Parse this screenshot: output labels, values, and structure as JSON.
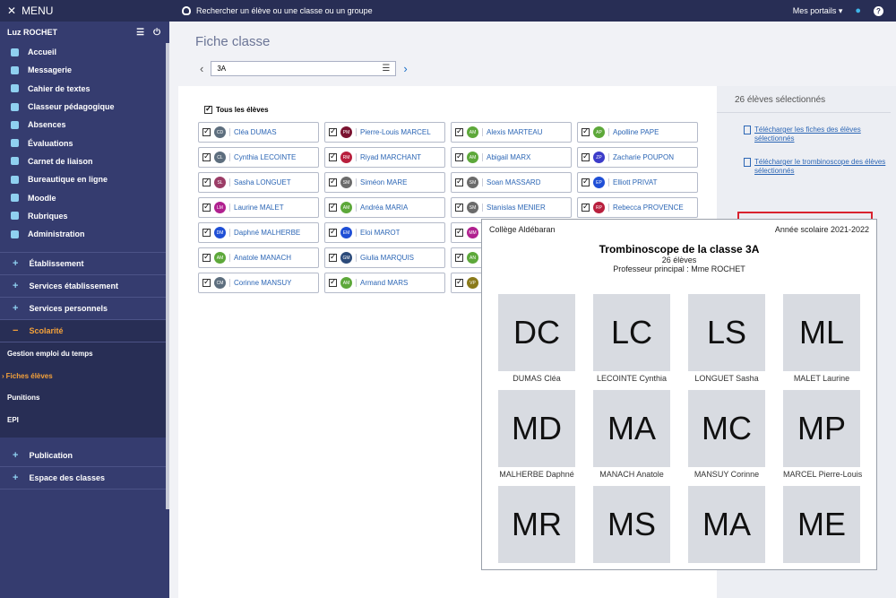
{
  "topbar": {
    "search_text": "Rechercher un élève ou une classe ou un groupe",
    "portals": "Mes portails"
  },
  "sidebar": {
    "menu_label": "MENU",
    "user": "Luz ROCHET",
    "items": [
      "Accueil",
      "Messagerie",
      "Cahier de textes",
      "Classeur pédagogique",
      "Absences",
      "Évaluations",
      "Carnet de liaison",
      "Bureautique en ligne",
      "Moodle",
      "Rubriques",
      "Administration"
    ],
    "sections_top": [
      "Établissement",
      "Services établissement",
      "Services personnels"
    ],
    "active_section": "Scolarité",
    "subitems": [
      "Gestion emploi du temps",
      "Fiches élèves",
      "Punitions",
      "EPI"
    ],
    "sections_bottom": [
      "Publication",
      "Espace des classes"
    ]
  },
  "page": {
    "title": "Fiche classe",
    "class_value": "3A",
    "all_students": "Tous les élèves"
  },
  "students": [
    {
      "name": "Cléa DUMAS",
      "initials": "CD",
      "color": "#5d6e7e"
    },
    {
      "name": "Pierre-Louis MARCEL",
      "initials": "PM",
      "color": "#7a1230"
    },
    {
      "name": "Alexis MARTEAU",
      "initials": "AM",
      "color": "#5da83a"
    },
    {
      "name": "Apolline PAPE",
      "initials": "AP",
      "color": "#5da83a"
    },
    {
      "name": "Cynthia LECOINTE",
      "initials": "CL",
      "color": "#5d6e7e"
    },
    {
      "name": "Riyad MARCHANT",
      "initials": "RM",
      "color": "#b81f3d"
    },
    {
      "name": "Abigail MARX",
      "initials": "AM",
      "color": "#5da83a"
    },
    {
      "name": "Zacharie POUPON",
      "initials": "ZP",
      "color": "#3c3cc9"
    },
    {
      "name": "Sasha LONGUET",
      "initials": "SL",
      "color": "#9b3c66"
    },
    {
      "name": "Siméon MARE",
      "initials": "SM",
      "color": "#6b6b6b"
    },
    {
      "name": "Soan MASSARD",
      "initials": "SM",
      "color": "#6b6b6b"
    },
    {
      "name": "Elliott PRIVAT",
      "initials": "EP",
      "color": "#1f4fd6"
    },
    {
      "name": "Laurine MALET",
      "initials": "LM",
      "color": "#b0208f"
    },
    {
      "name": "Andréa MARIA",
      "initials": "AM",
      "color": "#5da83a"
    },
    {
      "name": "Stanislas MENIER",
      "initials": "SM",
      "color": "#6b6b6b"
    },
    {
      "name": "Rebecca PROVENCE",
      "initials": "RP",
      "color": "#b81f3d"
    },
    {
      "name": "Daphné MALHERBE",
      "initials": "DM",
      "color": "#1f4fd6"
    },
    {
      "name": "Eloi MAROT",
      "initials": "EM",
      "color": "#1f4fd6"
    },
    {
      "name": "",
      "initials": "MM",
      "color": "#b0208f"
    },
    {
      "name": "",
      "initials": "",
      "color": "#ffffff"
    },
    {
      "name": "Anatole MANACH",
      "initials": "AM",
      "color": "#5da83a"
    },
    {
      "name": "Giulia MARQUIS",
      "initials": "GM",
      "color": "#2b4a7a"
    },
    {
      "name": "",
      "initials": "AN",
      "color": "#5da83a"
    },
    {
      "name": "",
      "initials": "",
      "color": "#ffffff"
    },
    {
      "name": "Corinne MANSUY",
      "initials": "CM",
      "color": "#5d6e7e"
    },
    {
      "name": "Armand MARS",
      "initials": "AM",
      "color": "#5da83a"
    },
    {
      "name": "",
      "initials": "VP",
      "color": "#8a7a1a"
    },
    {
      "name": "",
      "initials": "",
      "color": "#ffffff"
    }
  ],
  "right_panel": {
    "count": "26 élèves sélectionnés",
    "link1": "Télécharger les fiches des élèves sélectionnés",
    "link2": "Télécharger le trombinoscope des élèves sélectionnés"
  },
  "trombinoscope": {
    "school": "Collège Aldébaran",
    "year": "Année scolaire 2021-2022",
    "title": "Trombinoscope de la classe 3A",
    "count": "26 élèves",
    "prof": "Professeur principal : Mme ROCHET",
    "photos": [
      {
        "initials": "DC",
        "name": "DUMAS Cléa"
      },
      {
        "initials": "LC",
        "name": "LECOINTE Cynthia"
      },
      {
        "initials": "LS",
        "name": "LONGUET Sasha"
      },
      {
        "initials": "ML",
        "name": "MALET Laurine"
      },
      {
        "initials": "MD",
        "name": "MALHERBE Daphné"
      },
      {
        "initials": "MA",
        "name": "MANACH Anatole"
      },
      {
        "initials": "MC",
        "name": "MANSUY Corinne"
      },
      {
        "initials": "MP",
        "name": "MARCEL Pierre-Louis"
      },
      {
        "initials": "MR",
        "name": ""
      },
      {
        "initials": "MS",
        "name": ""
      },
      {
        "initials": "MA",
        "name": ""
      },
      {
        "initials": "ME",
        "name": ""
      }
    ]
  }
}
